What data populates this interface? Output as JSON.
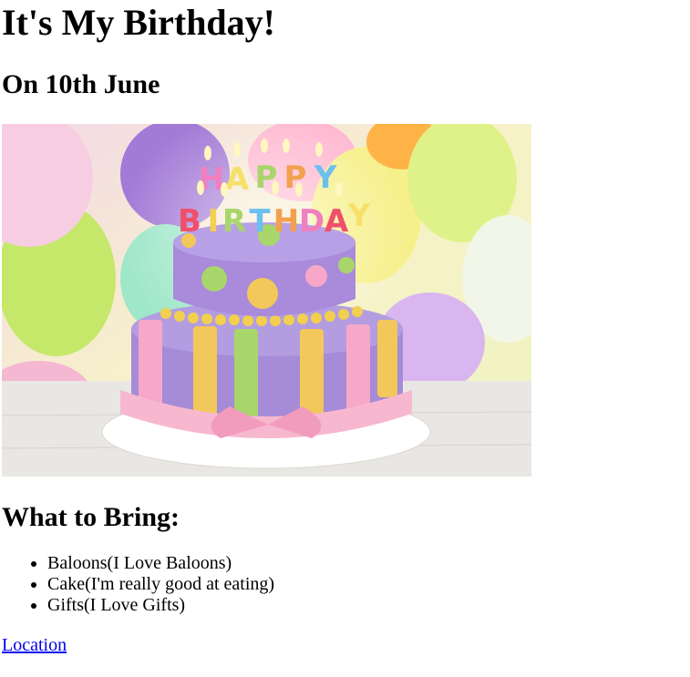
{
  "heading": "It's My Birthday!",
  "date": "On 10th June",
  "image": {
    "alt": "Birthday cake",
    "text": "HAPPY BIRTHDAY"
  },
  "bring_heading": "What to Bring:",
  "bring_items": [
    "Baloons(I Love Baloons)",
    "Cake(I'm really good at eating)",
    "Gifts(I Love Gifts)"
  ],
  "location_link": "Location",
  "colors": {
    "link": "#0000ee"
  }
}
